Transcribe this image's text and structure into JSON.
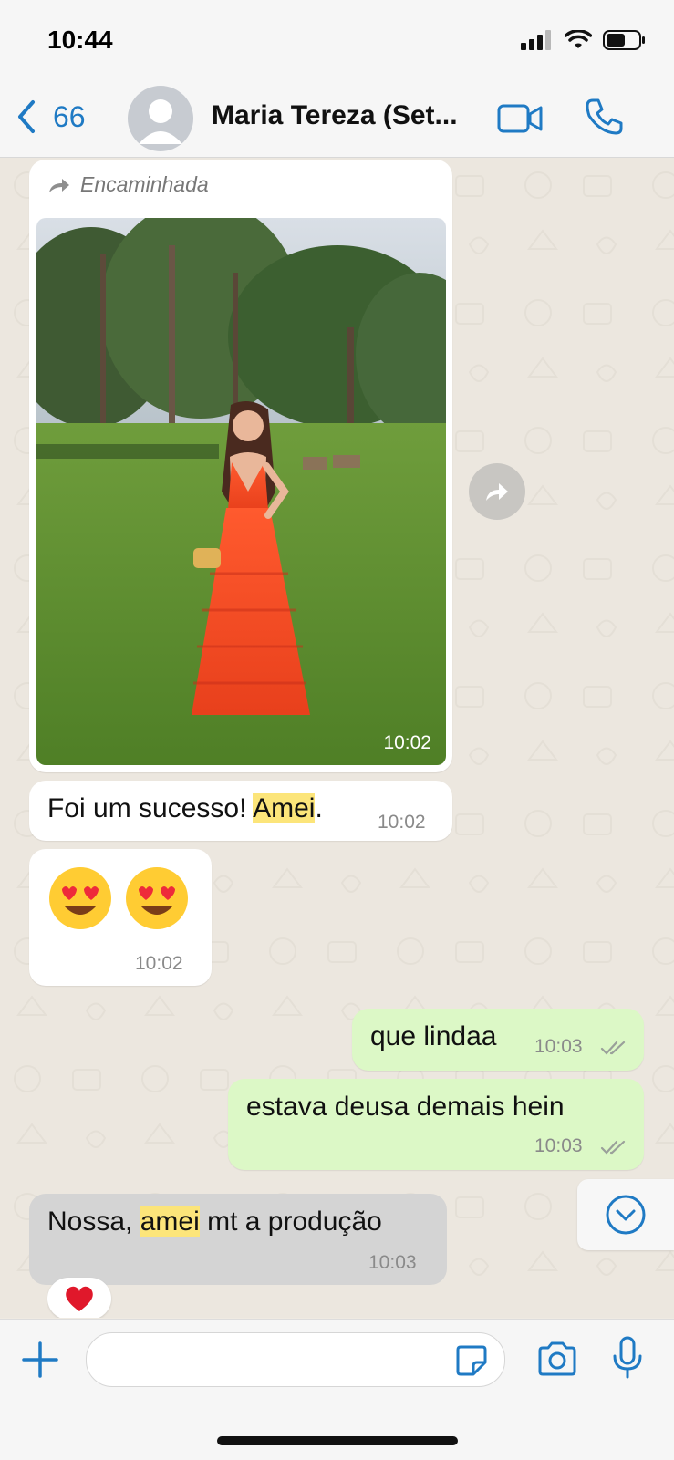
{
  "status": {
    "time": "10:44"
  },
  "header": {
    "back_count": "66",
    "contact_name": "Maria Tereza (Set..."
  },
  "messages": [
    {
      "type": "image",
      "direction": "in",
      "forwarded_label": "Encaminhada",
      "time": "10:02"
    },
    {
      "type": "text",
      "direction": "in",
      "text_before": "Foi um sucesso! ",
      "highlight": "Amei",
      "text_after": ".",
      "time": "10:02"
    },
    {
      "type": "emoji",
      "direction": "in",
      "emojis": [
        "heart-eyes",
        "heart-eyes"
      ],
      "time": "10:02"
    },
    {
      "type": "text",
      "direction": "out",
      "text": "que lindaa",
      "time": "10:03",
      "status": "read"
    },
    {
      "type": "text",
      "direction": "out",
      "text": "estava deusa demais hein",
      "time": "10:03",
      "status": "read"
    },
    {
      "type": "text",
      "direction": "in",
      "text_before": "Nossa, ",
      "highlight": "amei",
      "text_after": " mt a produção",
      "time": "10:03",
      "reaction": "heart"
    }
  ],
  "colors": {
    "accent": "#1f7ac4",
    "outgoing_bubble": "#dcf8c6",
    "incoming_bubble": "#ffffff",
    "highlight": "#fce57a",
    "chat_background": "#ece7df"
  }
}
